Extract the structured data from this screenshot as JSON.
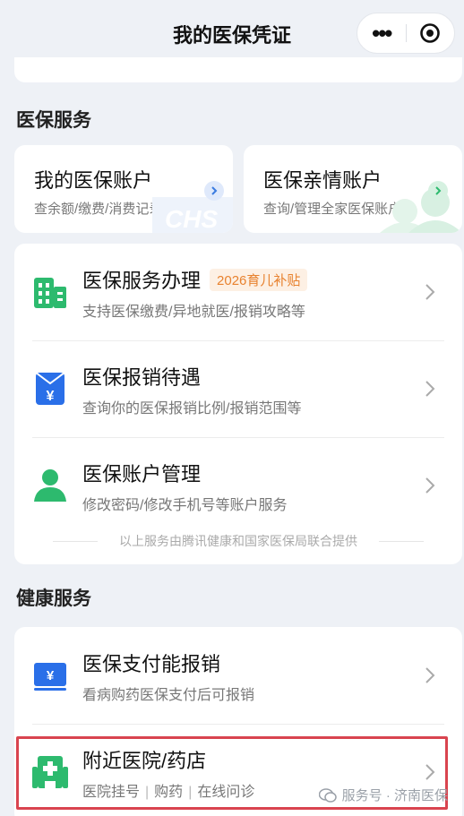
{
  "header": {
    "title": "我的医保凭证",
    "more_icon": "more-dots-icon",
    "target_icon": "target-circle-icon"
  },
  "medical_services": {
    "section_title": "医保服务",
    "account_card": {
      "title": "我的医保账户",
      "subtitle": "查余额/缴费/消费记录"
    },
    "family_card": {
      "title": "医保亲情账户",
      "subtitle": "查询/管理全家医保账户"
    },
    "items": [
      {
        "title": "医保服务办理",
        "badge": "2026育儿补贴",
        "subtitle": "支持医保缴费/异地就医/报销攻略等",
        "icon": "building-icon"
      },
      {
        "title": "医保报销待遇",
        "subtitle": "查询你的医保报销比例/报销范围等",
        "icon": "yuan-receipt-icon"
      },
      {
        "title": "医保账户管理",
        "subtitle": "修改密码/修改手机号等账户服务",
        "icon": "user-icon"
      }
    ],
    "footnote": "以上服务由腾讯健康和国家医保局联合提供"
  },
  "health_services": {
    "section_title": "健康服务",
    "items": [
      {
        "title": "医保支付能报销",
        "subtitle": "看病购药医保支付后可报销",
        "icon": "yuan-card-icon"
      },
      {
        "title": "附近医院/药店",
        "subtitle_parts": [
          "医院挂号",
          "购药",
          "在线问诊"
        ],
        "icon": "hospital-icon"
      }
    ]
  },
  "watermark": "服务号 · 济南医保",
  "colors": {
    "green": "#2dba6e",
    "blue": "#2a6fe8",
    "accent_orange": "#e8822f",
    "highlight_red": "#d9444f"
  }
}
